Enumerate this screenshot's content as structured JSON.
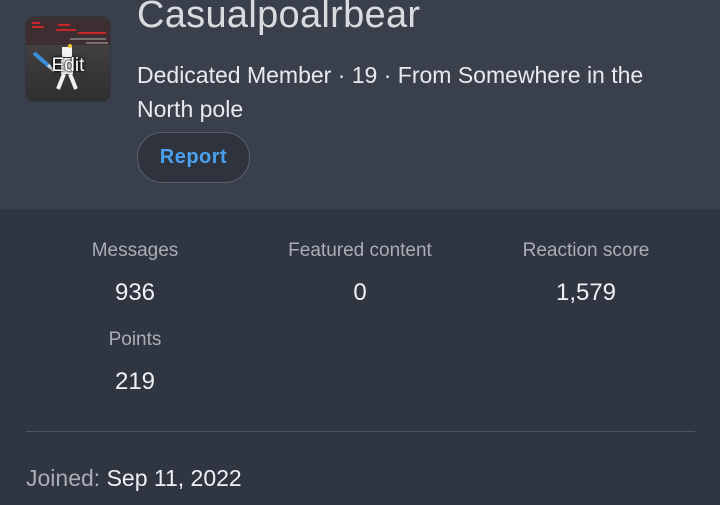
{
  "profile": {
    "username": "Casualpoalrbear",
    "blurb": "Dedicated Member · 19 · From Somewhere in the North pole",
    "avatar_edit_label": "Edit",
    "report_label": "Report"
  },
  "stats": [
    {
      "label": "Messages",
      "value": "936"
    },
    {
      "label": "Featured content",
      "value": "0"
    },
    {
      "label": "Reaction score",
      "value": "1,579"
    },
    {
      "label": "Points",
      "value": "219"
    }
  ],
  "joined": {
    "label": "Joined:",
    "value": "Sep 11, 2022"
  },
  "colors": {
    "header_bg": "#3a404b",
    "page_bg": "#2f3541",
    "accent": "#4aa0ef"
  }
}
